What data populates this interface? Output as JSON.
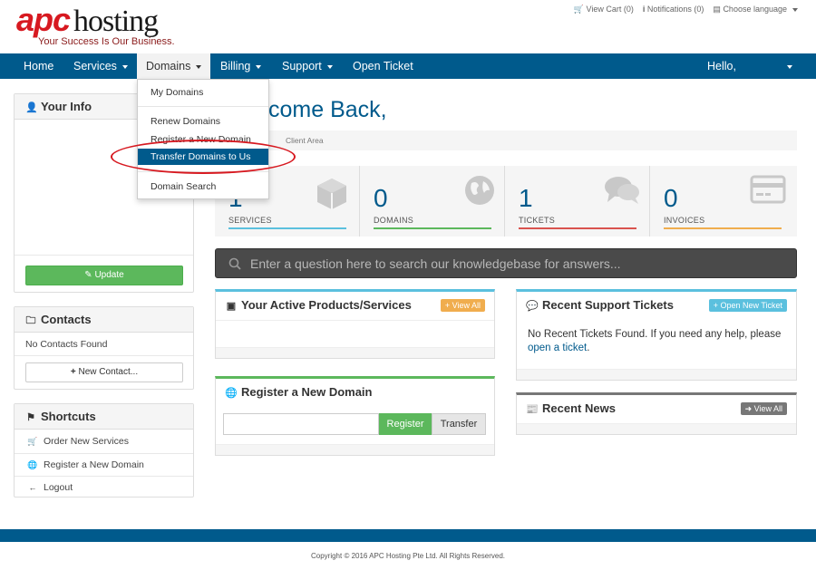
{
  "header": {
    "logo_brand": "apc",
    "logo_name": "hosting",
    "tagline": "Your Success Is Our Business.",
    "top_links": [
      {
        "icon": "cart-icon",
        "label": "View Cart (0)"
      },
      {
        "icon": "info-icon",
        "label": "Notifications (0)"
      },
      {
        "icon": "language-icon",
        "label": "Choose language"
      }
    ]
  },
  "nav": {
    "items": [
      {
        "label": "Home"
      },
      {
        "label": "Services"
      },
      {
        "label": "Domains"
      },
      {
        "label": "Billing"
      },
      {
        "label": "Support"
      },
      {
        "label": "Open Ticket"
      }
    ],
    "user": "Hello,"
  },
  "domains_menu": {
    "items": [
      {
        "label": "My Domains"
      },
      {
        "label": "Renew Domains"
      },
      {
        "label": "Register a New Domain"
      },
      {
        "label": "Transfer Domains to Us"
      },
      {
        "label": "Domain Search"
      }
    ]
  },
  "sidebar": {
    "your_info": {
      "title": "Your Info",
      "update_label": "Update"
    },
    "contacts": {
      "title": "Contacts",
      "empty_text": "No Contacts Found",
      "new_contact_label": "New Contact..."
    },
    "shortcuts": {
      "title": "Shortcuts",
      "items": [
        {
          "icon": "cart-icon",
          "label": "Order New Services"
        },
        {
          "icon": "globe-icon",
          "label": "Register a New Domain"
        },
        {
          "icon": "arrow-left-icon",
          "label": "Logout"
        }
      ]
    }
  },
  "main": {
    "welcome": "come Back,",
    "breadcrumb": "Client Area",
    "stats": [
      {
        "value": "1",
        "label": "SERVICES",
        "icon": "cube-icon",
        "color": "#5bc0de"
      },
      {
        "value": "0",
        "label": "DOMAINS",
        "icon": "globe-icon",
        "color": "#5cb85c"
      },
      {
        "value": "1",
        "label": "TICKETS",
        "icon": "comments-icon",
        "color": "#d9534f"
      },
      {
        "value": "0",
        "label": "INVOICES",
        "icon": "credit-card-icon",
        "color": "#f0ad4e"
      }
    ],
    "kb_search_placeholder": "Enter a question here to search our knowledgebase for answers...",
    "active_products": {
      "title": "Your Active Products/Services",
      "button": "View All"
    },
    "register_domain": {
      "title": "Register a New Domain",
      "register_label": "Register",
      "transfer_label": "Transfer"
    },
    "support_tickets": {
      "title": "Recent Support Tickets",
      "button": "Open New Ticket",
      "text": "No Recent Tickets Found. If you need any help, please",
      "link": "open a ticket",
      "text_end": "."
    },
    "news": {
      "title": "Recent News",
      "button": "View All"
    }
  },
  "footer": {
    "copyright": "Copyright © 2016 APC Hosting Pte Ltd. All Rights Reserved."
  },
  "colors": {
    "nav": "#005a8c",
    "accent_red": "#d71920",
    "success": "#5cb85c",
    "warning": "#f0ad4e",
    "info": "#5bc0de"
  }
}
